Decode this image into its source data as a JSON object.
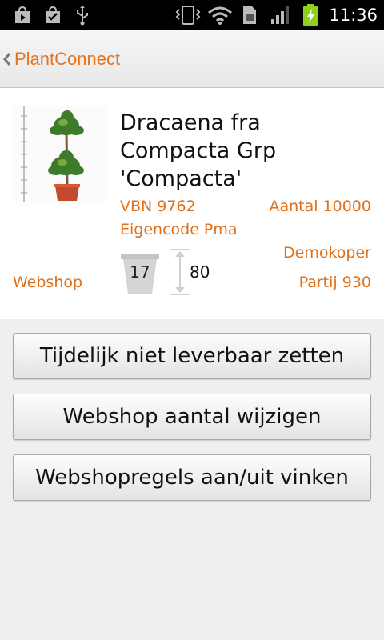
{
  "status_bar": {
    "time": "11:36",
    "icons": [
      "play-store-icon",
      "shopping-bag-icon",
      "usb-icon",
      "vibrate-icon",
      "wifi-icon",
      "sim-icon",
      "signal-icon",
      "battery-charging-icon"
    ]
  },
  "action_bar": {
    "title": "PlantConnect"
  },
  "product": {
    "name": "Dracaena fra Compacta Grp 'Compacta'",
    "vbn": "VBN 9762",
    "aantal": "Aantal 10000",
    "eigencode": "Eigencode Pma",
    "demokoper": "Demokoper",
    "webshop": "Webshop",
    "partij": "Partij 930",
    "pot_size": "17",
    "height": "80"
  },
  "buttons": {
    "unavailable": "Tijdelijk niet leverbaar zetten",
    "change_amount": "Webshop aantal wijzigen",
    "toggle_rules": "Webshopregels aan/uit vinken"
  },
  "colors": {
    "accent": "#e07019",
    "statusbar": "#000000",
    "background": "#efefef"
  }
}
